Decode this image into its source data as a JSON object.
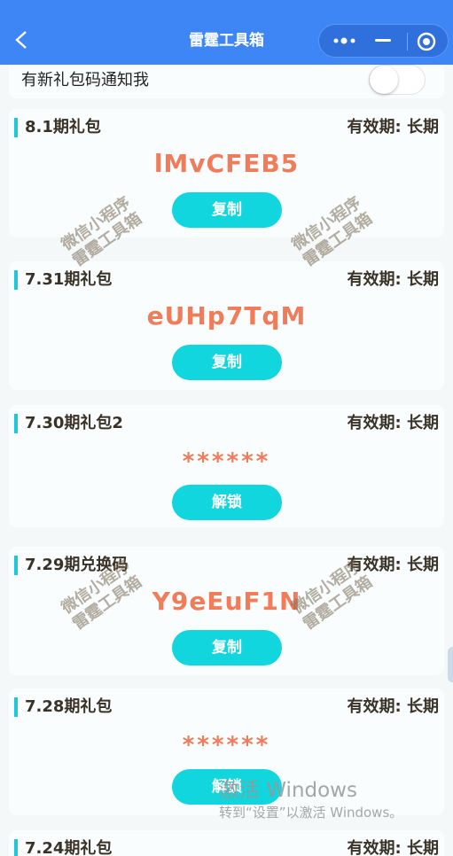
{
  "navbar": {
    "title": "雷霆工具箱",
    "bg_color": "#3e86f5",
    "back_icon": "chevron-left-icon",
    "more_icon": "more-dots-icon",
    "minimize_icon": "minus-icon",
    "close_icon": "target-circle-icon"
  },
  "notify": {
    "label": "有新礼包码通知我",
    "toggle_on": false
  },
  "cards": [
    {
      "title": "8.1期礼包",
      "validity": "有效期: 长期",
      "code": "lMvCFEB5",
      "button": "复制"
    },
    {
      "title": "7.31期礼包",
      "validity": "有效期: 长期",
      "code": "eUHp7TqM",
      "button": "复制"
    },
    {
      "title": "7.30期礼包2",
      "validity": "有效期: 长期",
      "code": "******",
      "button": "解锁"
    },
    {
      "title": "7.29期兑换码",
      "validity": "有效期: 长期",
      "code": "Y9eEuF1N",
      "button": "复制"
    },
    {
      "title": "7.28期礼包",
      "validity": "有效期: 长期",
      "code": "******",
      "button": "解锁"
    },
    {
      "title": "7.24期礼包",
      "validity": "有效期: 长期"
    }
  ],
  "watermark": {
    "line1": "微信小程序",
    "line2": "雷霆工具箱"
  },
  "windows_activation": {
    "line1": "激活 Windows",
    "line2": "转到“设置”以激活 Windows。"
  },
  "colors": {
    "accent_bar": "#1ec8d8",
    "code": "#f07c5a",
    "button": "#12d6dd"
  }
}
